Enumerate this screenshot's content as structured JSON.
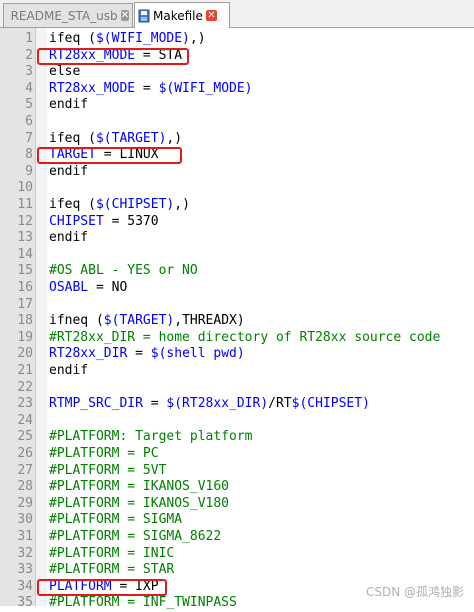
{
  "tabs": [
    {
      "label": "README_STA_usb",
      "active": false
    },
    {
      "label": "Makefile",
      "active": true
    }
  ],
  "colors": {
    "highlight_box": "#e01b1b",
    "keyword": "#000000",
    "variable": "#0000ff",
    "comment": "#008000"
  },
  "lines": [
    {
      "n": "1",
      "tokens": [
        [
          "kw",
          "ifeq ("
        ],
        [
          "var",
          "$(WIFI_MODE)"
        ],
        [
          "kw",
          ",)"
        ]
      ]
    },
    {
      "n": "2",
      "tokens": [
        [
          "var",
          "RT28xx_MODE"
        ],
        [
          "op",
          " = STA"
        ]
      ]
    },
    {
      "n": "3",
      "tokens": [
        [
          "kw",
          "else"
        ]
      ]
    },
    {
      "n": "4",
      "tokens": [
        [
          "var",
          "RT28xx_MODE"
        ],
        [
          "op",
          " = "
        ],
        [
          "var",
          "$(WIFI_MODE)"
        ]
      ]
    },
    {
      "n": "5",
      "tokens": [
        [
          "kw",
          "endif"
        ]
      ]
    },
    {
      "n": "6",
      "tokens": []
    },
    {
      "n": "7",
      "tokens": [
        [
          "kw",
          "ifeq ("
        ],
        [
          "var",
          "$(TARGET)"
        ],
        [
          "kw",
          ",)"
        ]
      ]
    },
    {
      "n": "8",
      "tokens": [
        [
          "var",
          "TARGET"
        ],
        [
          "op",
          " = LINUX"
        ]
      ]
    },
    {
      "n": "9",
      "tokens": [
        [
          "kw",
          "endif"
        ]
      ]
    },
    {
      "n": "10",
      "tokens": []
    },
    {
      "n": "11",
      "tokens": [
        [
          "kw",
          "ifeq ("
        ],
        [
          "var",
          "$(CHIPSET)"
        ],
        [
          "kw",
          ",)"
        ]
      ]
    },
    {
      "n": "12",
      "tokens": [
        [
          "var",
          "CHIPSET"
        ],
        [
          "op",
          " = 5370"
        ]
      ]
    },
    {
      "n": "13",
      "tokens": [
        [
          "kw",
          "endif"
        ]
      ]
    },
    {
      "n": "14",
      "tokens": []
    },
    {
      "n": "15",
      "tokens": [
        [
          "cm",
          "#OS ABL - YES or NO"
        ]
      ]
    },
    {
      "n": "16",
      "tokens": [
        [
          "var",
          "OSABL"
        ],
        [
          "op",
          " = NO"
        ]
      ]
    },
    {
      "n": "17",
      "tokens": []
    },
    {
      "n": "18",
      "tokens": [
        [
          "kw",
          "ifneq ("
        ],
        [
          "var",
          "$(TARGET)"
        ],
        [
          "kw",
          ",THREADX)"
        ]
      ]
    },
    {
      "n": "19",
      "tokens": [
        [
          "cm",
          "#RT28xx_DIR = home directory of RT28xx source code"
        ]
      ]
    },
    {
      "n": "20",
      "tokens": [
        [
          "var",
          "RT28xx_DIR"
        ],
        [
          "op",
          " = "
        ],
        [
          "var",
          "$(shell pwd)"
        ]
      ]
    },
    {
      "n": "21",
      "tokens": [
        [
          "kw",
          "endif"
        ]
      ]
    },
    {
      "n": "22",
      "tokens": []
    },
    {
      "n": "23",
      "tokens": [
        [
          "var",
          "RTMP_SRC_DIR"
        ],
        [
          "op",
          " = "
        ],
        [
          "var",
          "$(RT28xx_DIR)"
        ],
        [
          "op",
          "/RT"
        ],
        [
          "var",
          "$(CHIPSET)"
        ]
      ]
    },
    {
      "n": "24",
      "tokens": []
    },
    {
      "n": "25",
      "tokens": [
        [
          "cm",
          "#PLATFORM: Target platform"
        ]
      ]
    },
    {
      "n": "26",
      "tokens": [
        [
          "cm",
          "#PLATFORM = PC"
        ]
      ]
    },
    {
      "n": "27",
      "tokens": [
        [
          "cm",
          "#PLATFORM = 5VT"
        ]
      ]
    },
    {
      "n": "28",
      "tokens": [
        [
          "cm",
          "#PLATFORM = IKANOS_V160"
        ]
      ]
    },
    {
      "n": "29",
      "tokens": [
        [
          "cm",
          "#PLATFORM = IKANOS_V180"
        ]
      ]
    },
    {
      "n": "30",
      "tokens": [
        [
          "cm",
          "#PLATFORM = SIGMA"
        ]
      ]
    },
    {
      "n": "31",
      "tokens": [
        [
          "cm",
          "#PLATFORM = SIGMA_8622"
        ]
      ]
    },
    {
      "n": "32",
      "tokens": [
        [
          "cm",
          "#PLATFORM = INIC"
        ]
      ]
    },
    {
      "n": "33",
      "tokens": [
        [
          "cm",
          "#PLATFORM = STAR"
        ]
      ]
    },
    {
      "n": "34",
      "tokens": [
        [
          "var",
          "PLATFORM"
        ],
        [
          "op",
          " = IXP"
        ]
      ]
    },
    {
      "n": "35",
      "tokens": [
        [
          "cm",
          "#PLATFORM = INF_TWINPASS"
        ]
      ]
    }
  ],
  "highlighted_lines": [
    "2",
    "8",
    "34"
  ],
  "watermark": "CSDN @孤鸿独影"
}
